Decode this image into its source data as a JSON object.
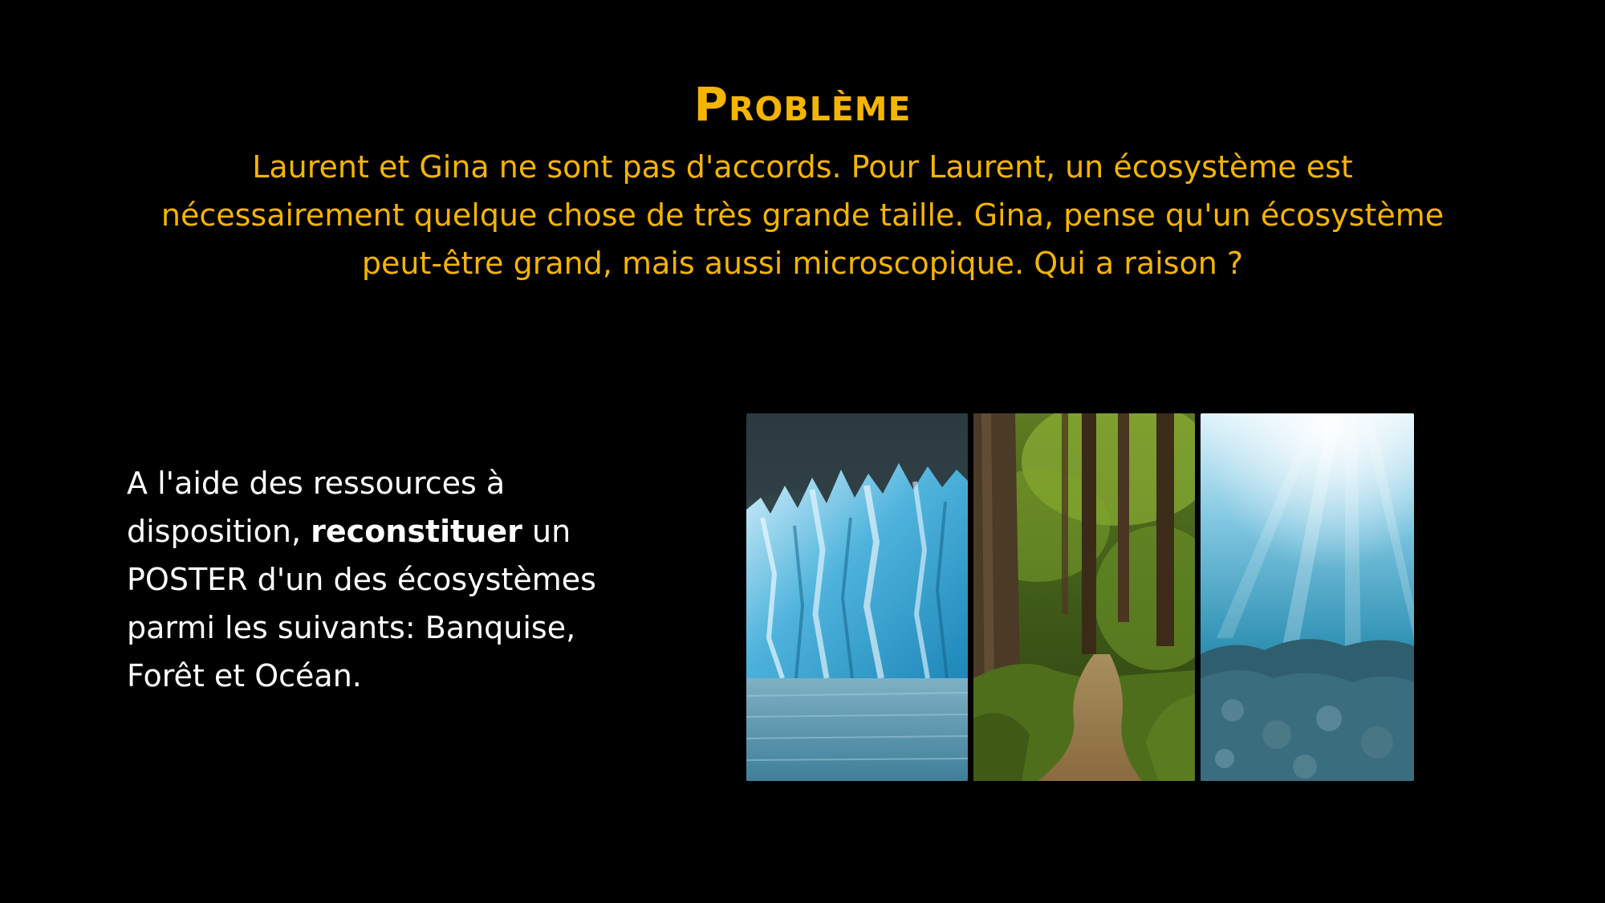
{
  "slide": {
    "title": "Problème",
    "problem_text": "Laurent et Gina ne sont pas d'accords. Pour Laurent, un écosystème est nécessairement quelque chose de très grande taille. Gina, pense qu'un écosystème peut-être grand, mais aussi microscopique. Qui a raison ?",
    "instructions": {
      "part1": "A l'aide des ressources à disposition, ",
      "bold": "reconstituer",
      "part2": " un POSTER d'un des écosystèmes parmi les suivants: Banquise, Forêt et Océan."
    }
  },
  "colors": {
    "background": "#000000",
    "accent": "#F5B400",
    "body_text": "#FFFFFF"
  },
  "images": [
    {
      "icon": "glacier-image"
    },
    {
      "icon": "forest-path-image"
    },
    {
      "icon": "underwater-ocean-image"
    }
  ]
}
